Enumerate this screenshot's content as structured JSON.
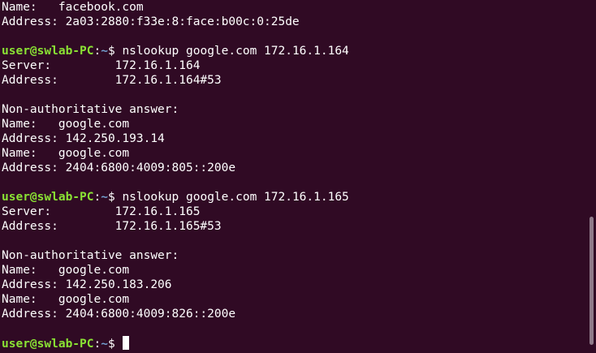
{
  "prompt": {
    "user": "user@swlab-PC",
    "sep": ":",
    "path": "~",
    "symbol": "$ "
  },
  "output": {
    "l0": "Name:   facebook.com",
    "l1": "Address: 2a03:2880:f33e:8:face:b00c:0:25de",
    "l2": "",
    "cmd1": "nslookup google.com 172.16.1.164",
    "l4": "Server:         172.16.1.164",
    "l5": "Address:        172.16.1.164#53",
    "l6": "",
    "l7": "Non-authoritative answer:",
    "l8": "Name:   google.com",
    "l9": "Address: 142.250.193.14",
    "l10": "Name:   google.com",
    "l11": "Address: 2404:6800:4009:805::200e",
    "l12": "",
    "cmd2": "nslookup google.com 172.16.1.165",
    "l14": "Server:         172.16.1.165",
    "l15": "Address:        172.16.1.165#53",
    "l16": "",
    "l17": "Non-authoritative answer:",
    "l18": "Name:   google.com",
    "l19": "Address: 142.250.183.206",
    "l20": "Name:   google.com",
    "l21": "Address: 2404:6800:4009:826::200e",
    "l22": ""
  },
  "colors": {
    "background": "#300a24",
    "prompt_user": "#8ae234",
    "prompt_path": "#729fcf",
    "text": "#ffffff"
  }
}
